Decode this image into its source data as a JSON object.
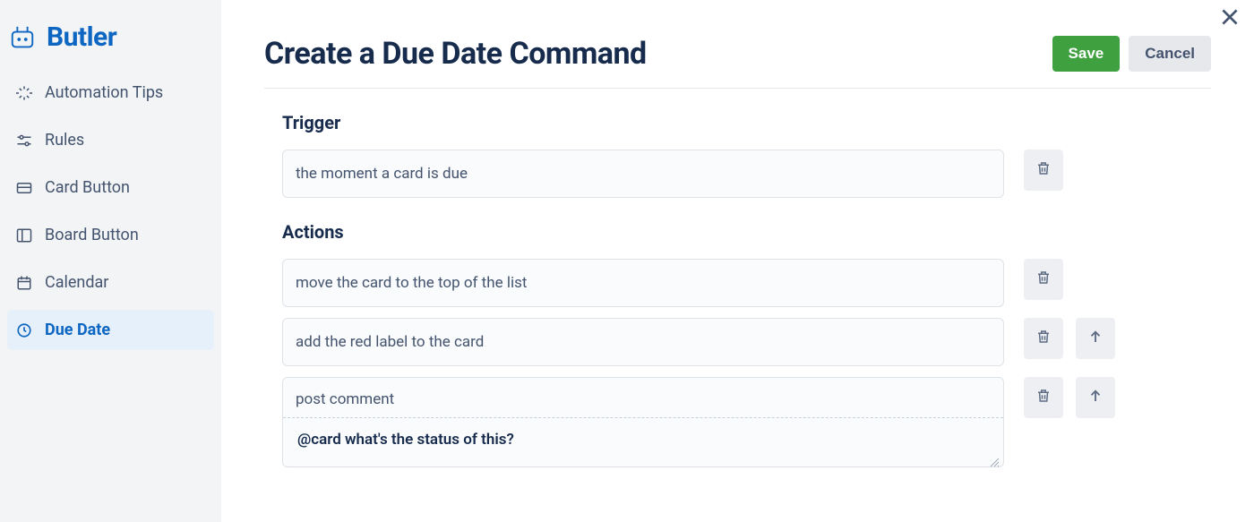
{
  "app": {
    "name": "Butler"
  },
  "sidebar": {
    "items": [
      {
        "label": "Automation Tips",
        "icon": "sparkle-icon",
        "active": false
      },
      {
        "label": "Rules",
        "icon": "sliders-icon",
        "active": false
      },
      {
        "label": "Card Button",
        "icon": "card-icon",
        "active": false
      },
      {
        "label": "Board Button",
        "icon": "board-icon",
        "active": false
      },
      {
        "label": "Calendar",
        "icon": "calendar-icon",
        "active": false
      },
      {
        "label": "Due Date",
        "icon": "clock-icon",
        "active": true
      }
    ]
  },
  "header": {
    "title": "Create a Due Date Command",
    "save_label": "Save",
    "cancel_label": "Cancel"
  },
  "sections": {
    "trigger_label": "Trigger",
    "actions_label": "Actions"
  },
  "trigger": {
    "text": "the moment a card is due"
  },
  "actions": [
    {
      "text": "move the card to the top of the list",
      "has_up": false,
      "has_comment": false
    },
    {
      "text": "add the red label to the card",
      "has_up": true,
      "has_comment": false
    },
    {
      "text": "post comment",
      "has_up": true,
      "has_comment": true,
      "comment": "@card what's the status of this?"
    }
  ]
}
